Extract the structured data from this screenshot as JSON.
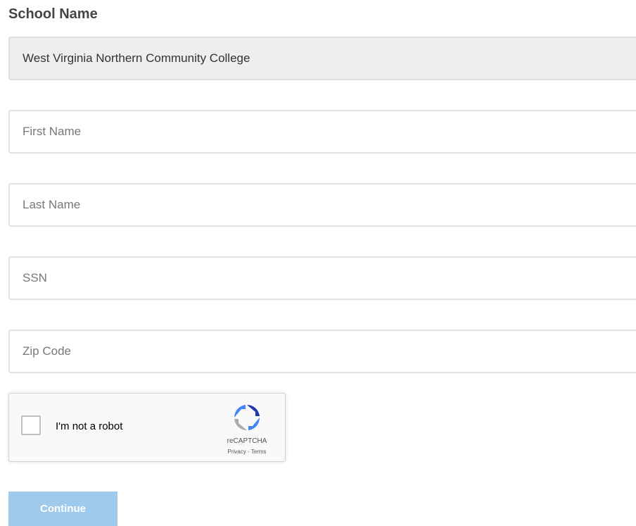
{
  "form": {
    "school_label": "School Name",
    "school_value": "West Virginia Northern Community College",
    "first_name_placeholder": "First Name",
    "last_name_placeholder": "Last Name",
    "ssn_placeholder": "SSN",
    "zip_placeholder": "Zip Code",
    "continue_label": "Continue"
  },
  "recaptcha": {
    "label": "I'm not a robot",
    "brand": "reCAPTCHA",
    "privacy": "Privacy",
    "separator": " - ",
    "terms": "Terms",
    "icon": "recaptcha-logo-icon"
  },
  "colors": {
    "continue_button": "#9fcaeb",
    "readonly_field": "#eeeeee",
    "field_border": "#e2e2e2"
  }
}
